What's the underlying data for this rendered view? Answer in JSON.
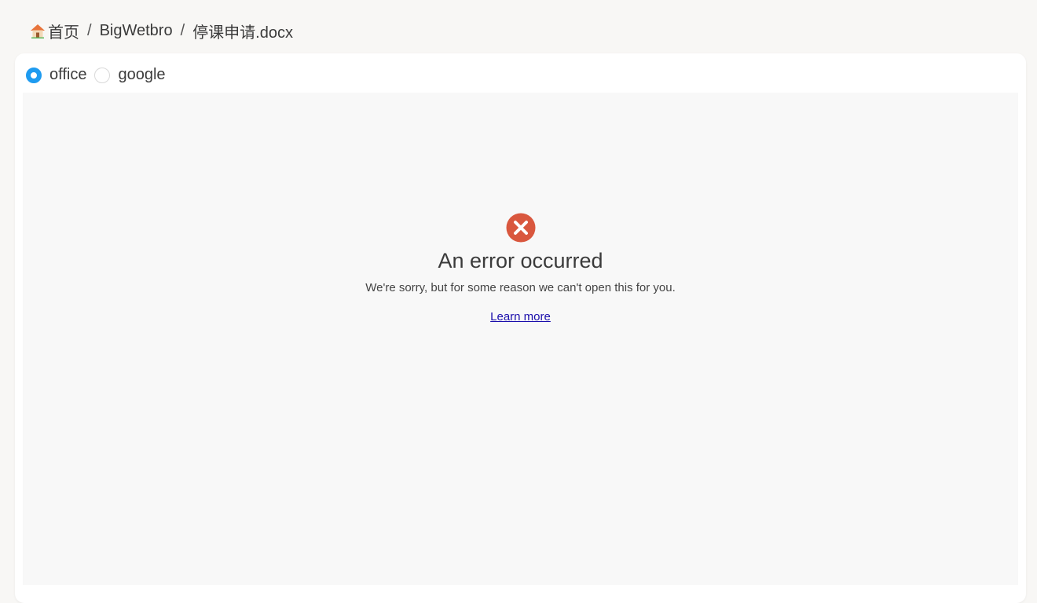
{
  "breadcrumb": {
    "home_icon": "house-icon",
    "home": "首页",
    "separator": "/",
    "folder": "BigWetbro",
    "file": "停课申请.docx"
  },
  "viewer_options": {
    "selected": "office",
    "office_label": "office",
    "google_label": "google",
    "accent_color": "#1e9bf0"
  },
  "error": {
    "icon": "error-x-circle-icon",
    "icon_color": "#d9573e",
    "title": "An error occurred",
    "message": "We're sorry, but for some reason we can't open this for you.",
    "link_label": "Learn more"
  }
}
